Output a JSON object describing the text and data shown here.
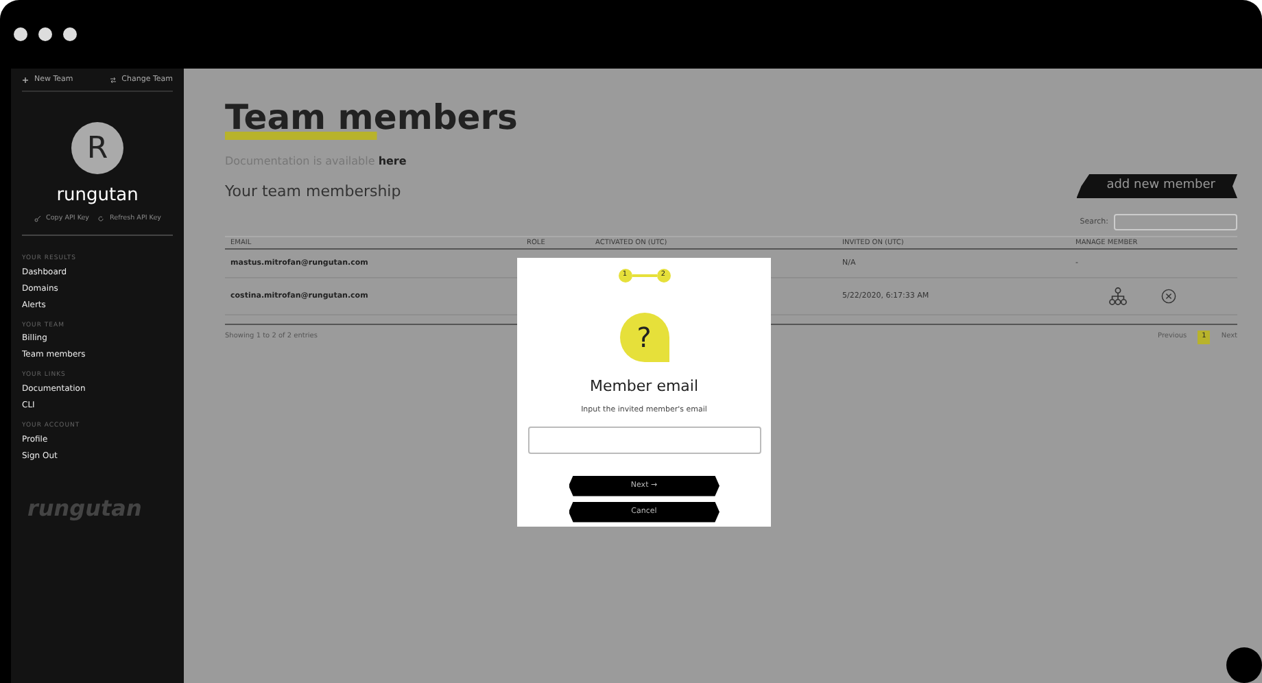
{
  "sidebar": {
    "top_actions": [
      {
        "kind": "plus",
        "label": "New Team"
      },
      {
        "kind": "swap",
        "label": "Change Team"
      }
    ],
    "avatar_letter": "R",
    "team_name": "rungutan",
    "key_actions": [
      {
        "kind": "key",
        "label": "Copy API Key"
      },
      {
        "kind": "refresh",
        "label": "Refresh API Key"
      }
    ],
    "sections": [
      {
        "heading": "YOUR RESULTS",
        "items": [
          "Dashboard",
          "Domains",
          "Alerts"
        ]
      },
      {
        "heading": "YOUR TEAM",
        "items": [
          "Billing",
          "Team members"
        ]
      },
      {
        "heading": "YOUR LINKS",
        "items": [
          "Documentation",
          "CLI"
        ]
      },
      {
        "heading": "YOUR ACCOUNT",
        "items": [
          "Profile",
          "Sign Out"
        ]
      }
    ],
    "logo": "rungutan"
  },
  "page": {
    "title": "Team members",
    "doc_text": "Documentation is available",
    "doc_link": "here",
    "subtitle": "Your team membership",
    "add_button": "add new member",
    "search_label": "Search:",
    "table": {
      "columns": [
        "EMAIL",
        "ROLE",
        "ACTIVATED ON (UTC)",
        "INVITED ON (UTC)",
        "MANAGE MEMBER"
      ],
      "rows": [
        {
          "email": "mastus.mitrofan@rungutan.com",
          "invited": "N/A",
          "manage": {
            "kind": "text",
            "text": "-"
          }
        },
        {
          "email": "costina.mitrofan@rungutan.com",
          "invited": "5/22/2020, 6:17:33 AM",
          "manage": {
            "kind": "actions"
          }
        }
      ]
    },
    "info": "Showing 1 to 2 of 2 entries",
    "previous": "Previous",
    "pages": [
      {
        "label": "1",
        "selected": true
      }
    ],
    "next": "Next"
  },
  "modal": {
    "steps": [
      "1",
      "2"
    ],
    "icon": "?",
    "title": "Member email",
    "prompt": "Input the invited member's email",
    "next_button": "Next →",
    "cancel_button": "Cancel"
  }
}
